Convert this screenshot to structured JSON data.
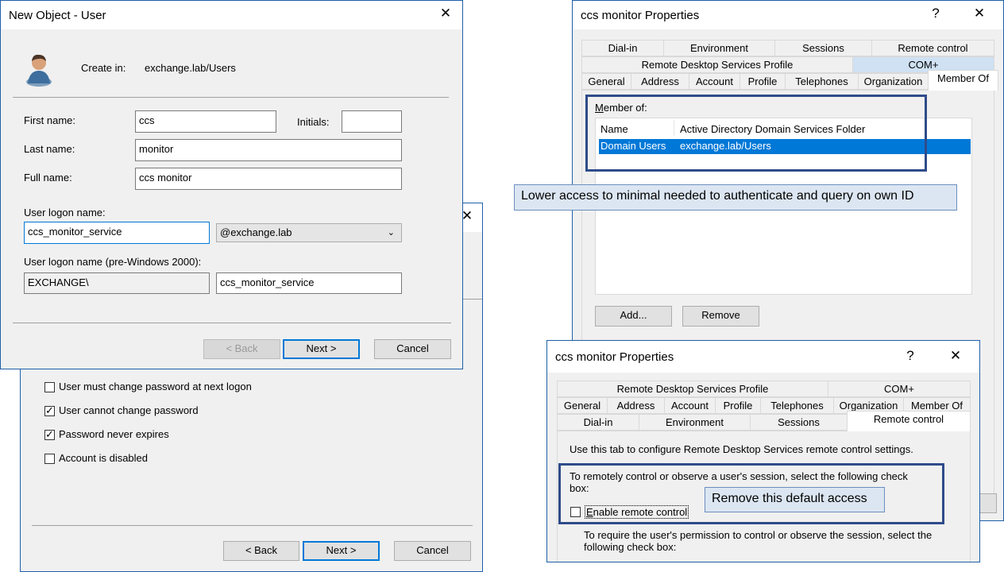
{
  "bg_window": {
    "checkboxes": [
      {
        "label": "User must change password at next logon",
        "checked": false
      },
      {
        "label": "User cannot change password",
        "checked": true
      },
      {
        "label": "Password never expires",
        "checked": true
      },
      {
        "label": "Account is disabled",
        "checked": false
      }
    ],
    "back_label": "< Back",
    "next_label": "Next >",
    "cancel_label": "Cancel"
  },
  "new_object": {
    "title": "New Object - User",
    "close_glyph": "✕",
    "create_in_label": "Create in:",
    "create_in_value": "exchange.lab/Users",
    "first_name_label": "First name:",
    "first_name_value": "ccs",
    "initials_label": "Initials:",
    "initials_value": "",
    "last_name_label": "Last name:",
    "last_name_value": "monitor",
    "full_name_label": "Full name:",
    "full_name_value": "ccs monitor",
    "logon_label": "User logon name:",
    "logon_value": "ccs_monitor_service",
    "domain_value": "@exchange.lab",
    "pre2000_label": "User logon name (pre-Windows 2000):",
    "pre2000_domain": "EXCHANGE\\",
    "pre2000_value": "ccs_monitor_service",
    "back_label": "< Back",
    "next_label": "Next >",
    "cancel_label": "Cancel"
  },
  "props_top": {
    "title": "ccs monitor Properties",
    "help_glyph": "?",
    "close_glyph": "✕",
    "tabs_row1": [
      "Dial-in",
      "Environment",
      "Sessions",
      "Remote control"
    ],
    "tabs_row2": [
      "Remote Desktop Services Profile",
      "COM+"
    ],
    "tabs_row3": [
      "General",
      "Address",
      "Account",
      "Profile",
      "Telephones",
      "Organization",
      "Member Of"
    ],
    "member_of_label": "Member of:",
    "col_name": "Name",
    "col_folder": "Active Directory Domain Services Folder",
    "rows": [
      {
        "name": "Domain Users",
        "folder": "exchange.lab/Users"
      }
    ],
    "add_label": "Add...",
    "remove_label": "Remove"
  },
  "props_bottom": {
    "title": "ccs monitor Properties",
    "help_glyph": "?",
    "close_glyph": "✕",
    "tabs_row1": [
      "Remote Desktop Services Profile",
      "COM+"
    ],
    "tabs_row2": [
      "General",
      "Address",
      "Account",
      "Profile",
      "Telephones",
      "Organization",
      "Member Of"
    ],
    "tabs_row3": [
      "Dial-in",
      "Environment",
      "Sessions",
      "Remote control"
    ],
    "intro": "Use this tab to configure Remote Desktop Services remote control settings.",
    "control_text": "To remotely control or observe a user's session, select the following check box:",
    "enable_label": "Enable remote control",
    "enable_checked": false,
    "permission_text": "To require the user's permission to control or observe the session, select the following check box:"
  },
  "callouts": {
    "top": "Lower access to minimal needed to authenticate and query on own ID",
    "bottom": "Remove this default access"
  },
  "colors": {
    "selection": "#0078d7",
    "callout_bg": "#dce6f2",
    "frame": "#2f4b8a"
  }
}
